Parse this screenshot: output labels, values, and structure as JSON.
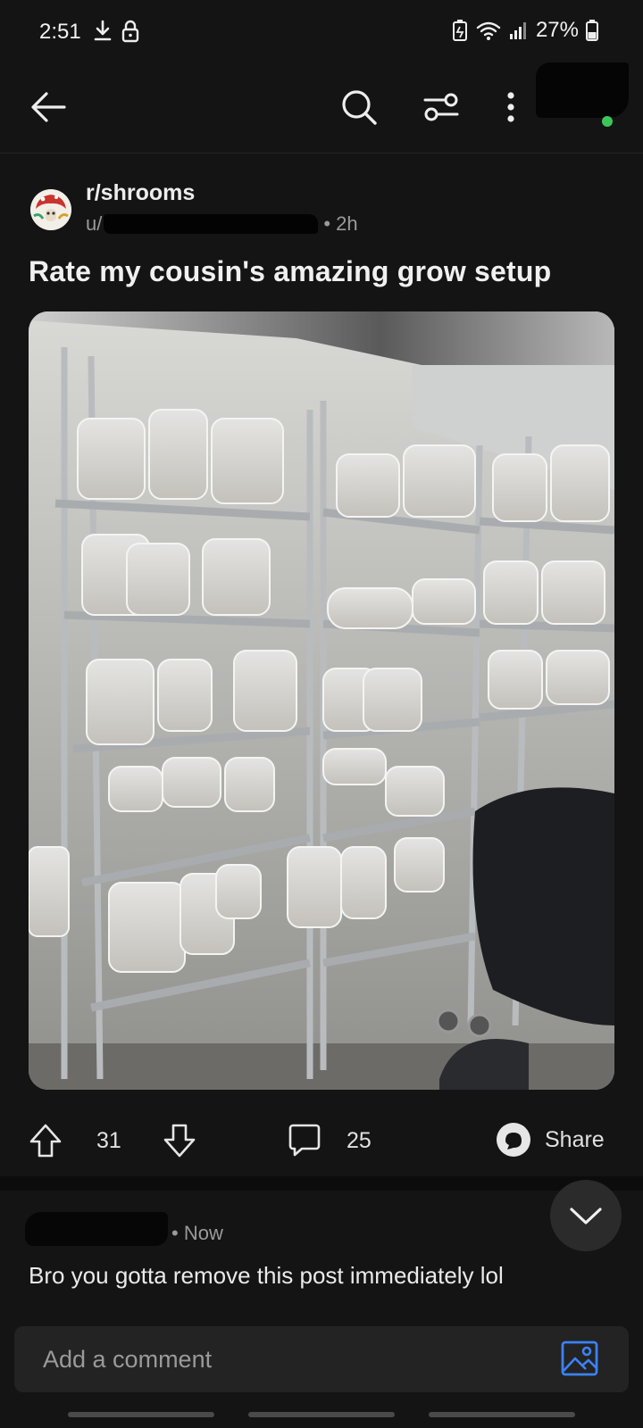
{
  "status_bar": {
    "time": "2:51",
    "battery_percent": "27%",
    "icons": [
      "download-icon",
      "lock-icon",
      "battery-saver-icon",
      "wifi-icon",
      "signal-icon",
      "battery-icon"
    ]
  },
  "top_nav": {
    "icons": [
      "back-arrow-icon",
      "search-icon",
      "filter-sort-icon",
      "more-vertical-icon"
    ],
    "account_online": true
  },
  "post": {
    "subreddit": "r/shrooms",
    "author_prefix": "u/",
    "age": "• 2h",
    "title": "Rate my cousin's amazing grow setup",
    "upvotes": "31",
    "comments": "25",
    "share_label": "Share"
  },
  "comment": {
    "time": "• Now",
    "text": "Bro you gotta remove this post immediately lol"
  },
  "composer": {
    "placeholder": "Add a comment"
  },
  "colors": {
    "background": "#141414",
    "accent_blue": "#3b82f6",
    "online_green": "#3cc65a"
  }
}
